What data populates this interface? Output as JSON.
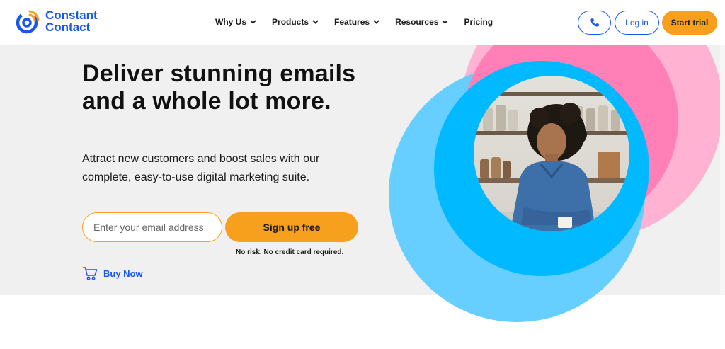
{
  "brand": {
    "name_line1": "Constant",
    "name_line2": "Contact",
    "color": "#1856ed"
  },
  "nav": {
    "items": [
      {
        "label": "Why Us",
        "has_dropdown": true
      },
      {
        "label": "Products",
        "has_dropdown": true
      },
      {
        "label": "Features",
        "has_dropdown": true
      },
      {
        "label": "Resources",
        "has_dropdown": true
      },
      {
        "label": "Pricing",
        "has_dropdown": false
      }
    ]
  },
  "header_actions": {
    "phone_icon": "phone-icon",
    "login_label": "Log in",
    "trial_label": "Start trial"
  },
  "hero": {
    "headline": "Deliver stunning emails and a whole lot more.",
    "subhead": "Attract new customers and boost sales with our complete, easy-to-use digital marketing suite.",
    "email_placeholder": "Enter your email address",
    "signup_label": "Sign up free",
    "disclaimer": "No risk. No credit card required.",
    "buy_now_label": "Buy Now",
    "cart_icon": "cart-icon"
  },
  "colors": {
    "accent_orange": "#f7a01d",
    "brand_blue": "#1856ed",
    "pink_light": "#ffb2d1",
    "pink": "#ff7fb6",
    "cyan_light": "#66cfff",
    "cyan": "#00b9ff",
    "hero_bg": "#f0f0f0"
  }
}
